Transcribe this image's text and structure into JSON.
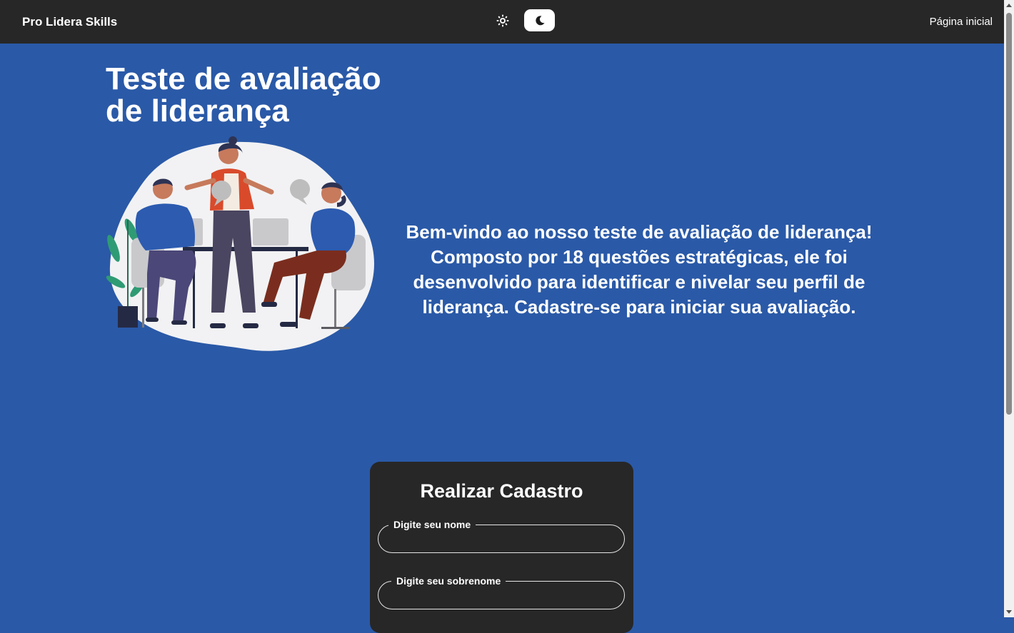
{
  "nav": {
    "brand": "Pro Lidera Skills",
    "home_link": "Página inicial",
    "theme_light_icon": "sun-icon",
    "theme_dark_icon": "moon-icon",
    "active_theme": "dark"
  },
  "hero": {
    "title_line1": "Teste de avaliação",
    "title_line2": "de liderança",
    "welcome_text": "Bem-vindo ao nosso teste de avaliação de liderança! Composto por 18 questões estratégicas, ele foi desenvolvido para identificar e nivelar seu perfil de liderança. Cadastre-se para iniciar sua avaliação."
  },
  "form": {
    "title": "Realizar Cadastro",
    "fields": [
      {
        "label": "Digite seu nome",
        "value": ""
      },
      {
        "label": "Digite seu sobrenome",
        "value": ""
      }
    ]
  },
  "colors": {
    "page_background": "#2a59a7",
    "nav_background": "#272727",
    "card_background": "#272727",
    "text": "#ffffff"
  }
}
